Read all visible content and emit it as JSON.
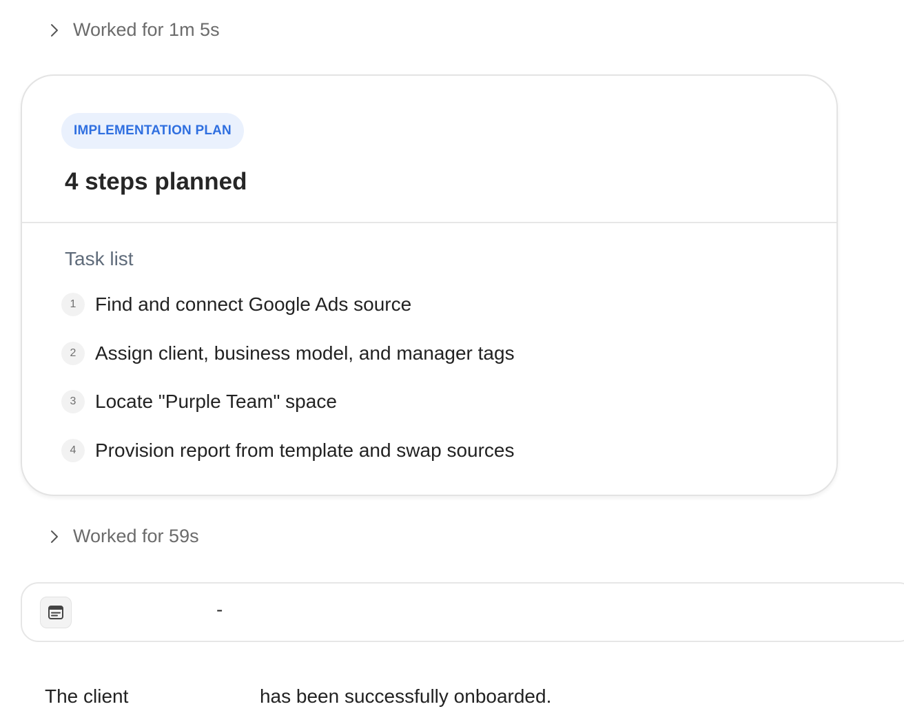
{
  "worked_1": {
    "label": "Worked for 1m 5s",
    "icon": "chevron-right-icon"
  },
  "plan": {
    "badge": "IMPLEMENTATION PLAN",
    "title": "4 steps planned",
    "task_list_label": "Task list",
    "tasks": [
      {
        "number": "1",
        "text": "Find and connect Google Ads source"
      },
      {
        "number": "2",
        "text": "Assign client, business model, and manager tags"
      },
      {
        "number": "3",
        "text": "Locate \"Purple Team\" space"
      },
      {
        "number": "4",
        "text": "Provision report from template and swap sources"
      }
    ],
    "colors": {
      "badge_bg": "#eaf1fd",
      "badge_text": "#2f6fe0"
    }
  },
  "worked_2": {
    "label": "Worked for 59s",
    "icon": "chevron-right-icon"
  },
  "result_card": {
    "icon": "document-icon",
    "title_suffix": "-"
  },
  "final_message": {
    "prefix": "The client",
    "suffix": "has been successfully onboarded."
  }
}
